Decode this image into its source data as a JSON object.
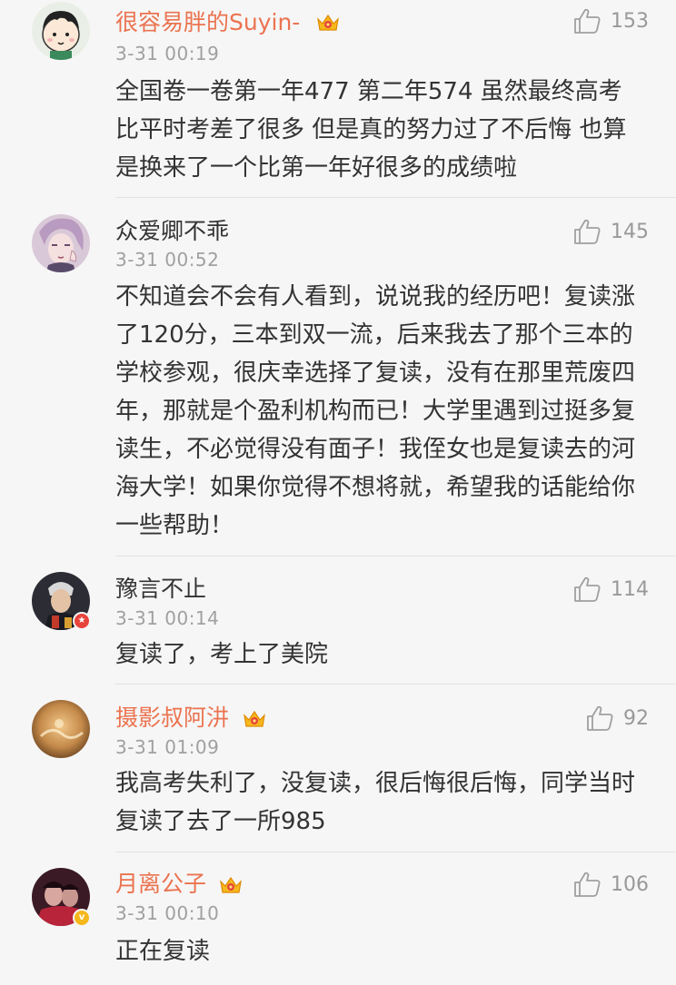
{
  "colors": {
    "vip_name": "#eb7350",
    "normal_name": "#333333",
    "timestamp": "#a0a0a0",
    "like": "#999999",
    "background": "#f6f6f6"
  },
  "comments": [
    {
      "username": "很容易胖的Suyin-",
      "timestamp": "3-31 00:19",
      "likes": "153",
      "text": "全国卷一卷第一年477  第二年574 虽然最终高考比平时考差了很多 但是真的努力过了不后悔 也算是换来了一个比第一年好很多的成绩啦",
      "vip": true,
      "badge": "none"
    },
    {
      "username": "众爱卿不乖",
      "timestamp": "3-31 00:52",
      "likes": "145",
      "text": "不知道会不会有人看到，说说我的经历吧！复读涨了120分，三本到双一流，后来我去了那个三本的学校参观，很庆幸选择了复读，没有在那里荒废四年，那就是个盈利机构而已！大学里遇到过挺多复读生，不必觉得没有面子！我侄女也是复读去的河海大学！如果你觉得不想将就，希望我的话能给你一些帮助！",
      "vip": false,
      "badge": "none"
    },
    {
      "username": "豫言不止",
      "timestamp": "3-31 00:14",
      "likes": "114",
      "text": "复读了，考上了美院",
      "vip": false,
      "badge": "red-star-badge"
    },
    {
      "username": "摄影叔阿汫",
      "timestamp": "3-31 01:09",
      "likes": "92",
      "text": "我高考失利了，没复读，很后悔很后悔，同学当时复读了去了一所985",
      "vip": true,
      "badge": "none"
    },
    {
      "username": "月离公子",
      "timestamp": "3-31 00:10",
      "likes": "106",
      "text": "正在复读",
      "vip": true,
      "badge": "yellow-v-badge"
    }
  ]
}
